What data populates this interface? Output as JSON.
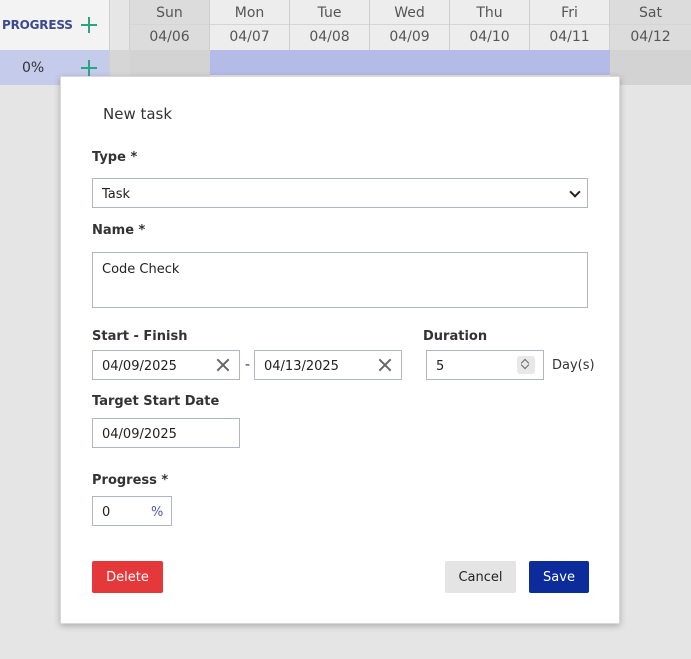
{
  "gantt": {
    "progress_header": "PROGRESS",
    "days": [
      {
        "name": "Sun",
        "date": "04/06",
        "weekend": true
      },
      {
        "name": "Mon",
        "date": "04/07",
        "weekend": false
      },
      {
        "name": "Tue",
        "date": "04/08",
        "weekend": false
      },
      {
        "name": "Wed",
        "date": "04/09",
        "weekend": false
      },
      {
        "name": "Thu",
        "date": "04/10",
        "weekend": false
      },
      {
        "name": "Fri",
        "date": "04/11",
        "weekend": false
      },
      {
        "name": "Sat",
        "date": "04/12",
        "weekend": true
      }
    ],
    "row_progress": "0%"
  },
  "modal": {
    "title": "New task",
    "type_label": "Type *",
    "type_value": "Task",
    "name_label": "Name *",
    "name_value": "Code Check",
    "start_finish_label": "Start - Finish",
    "start_value": "04/09/2025",
    "range_separator": "-",
    "finish_value": "04/13/2025",
    "duration_label": "Duration",
    "duration_value": "5",
    "duration_unit": "Day(s)",
    "target_start_label": "Target Start Date",
    "target_start_value": "04/09/2025",
    "progress_label": "Progress *",
    "progress_value": "0",
    "progress_unit": "%",
    "delete_label": "Delete",
    "cancel_label": "Cancel",
    "save_label": "Save"
  },
  "colors": {
    "accent_save": "#0d2c9c",
    "delete": "#e5383b",
    "add_icon": "#2aa57f",
    "task_bar": "#b4bbe6"
  }
}
